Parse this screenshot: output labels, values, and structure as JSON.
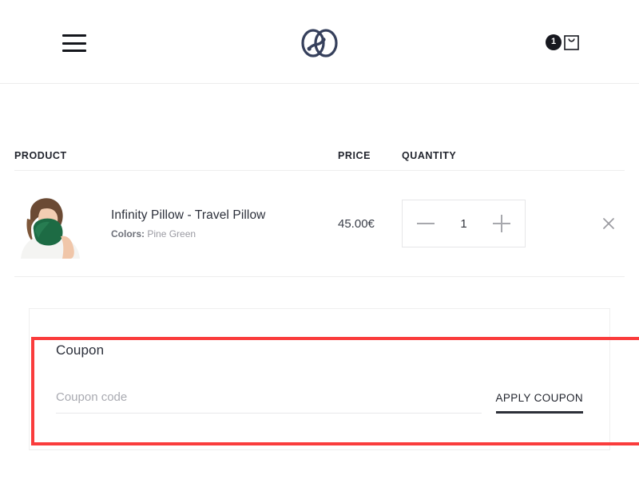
{
  "header": {
    "menu_icon": "hamburger-menu-icon",
    "logo_icon": "infinity-pillow-logo",
    "cart_icon": "shopping-bag-icon",
    "cart_count": "1"
  },
  "cart": {
    "columns": {
      "product": "PRODUCT",
      "price": "PRICE",
      "quantity": "QUANTITY"
    },
    "items": [
      {
        "title": "Infinity Pillow - Travel Pillow",
        "variant_label": "Colors:",
        "variant_value": "Pine Green",
        "price": "45.00€",
        "quantity": "1",
        "thumb_alt": "travel-pillow-thumbnail",
        "remove_icon": "close-x-icon",
        "decrease_icon": "minus-icon",
        "increase_icon": "plus-icon"
      }
    ]
  },
  "coupon": {
    "title": "Coupon",
    "placeholder": "Coupon code",
    "value": "",
    "apply_label": "APPLY COUPON",
    "highlight_color": "#fa3c3c"
  }
}
